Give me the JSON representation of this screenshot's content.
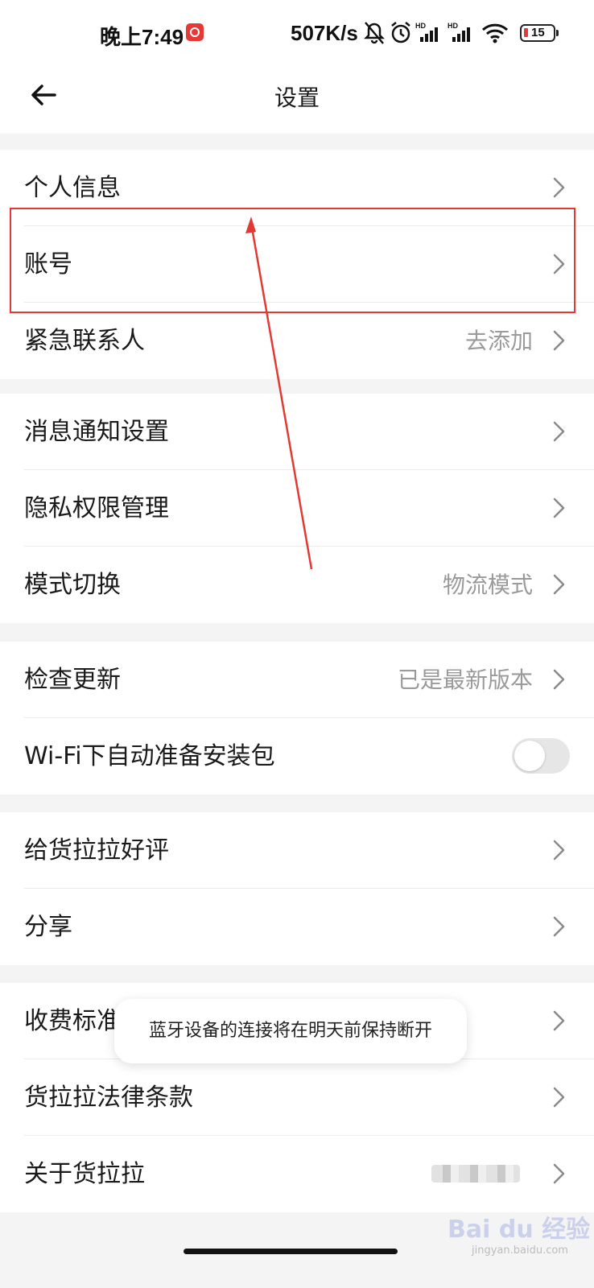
{
  "status_bar": {
    "time": "晚上7:49",
    "net_speed": "507K/s",
    "battery_level": "15",
    "icons": [
      "bell-muted-icon",
      "alarm-icon",
      "signal-hd-icon",
      "signal-hd-icon",
      "wifi-icon",
      "battery-icon"
    ]
  },
  "header": {
    "title": "设置",
    "back_icon": "arrow-left-icon"
  },
  "groups": [
    {
      "rows": [
        {
          "label": "个人信息",
          "value": ""
        },
        {
          "label": "账号",
          "value": ""
        },
        {
          "label": "紧急联系人",
          "value": "去添加"
        }
      ]
    },
    {
      "rows": [
        {
          "label": "消息通知设置",
          "value": ""
        },
        {
          "label": "隐私权限管理",
          "value": ""
        },
        {
          "label": "模式切换",
          "value": "物流模式"
        }
      ]
    },
    {
      "rows": [
        {
          "label": "检查更新",
          "value": "已是最新版本"
        },
        {
          "label": "Wi-Fi下自动准备安装包",
          "toggle_on": false
        }
      ]
    },
    {
      "rows": [
        {
          "label": "给货拉拉好评",
          "value": ""
        },
        {
          "label": "分享",
          "value": ""
        }
      ]
    },
    {
      "rows": [
        {
          "label": "收费标准",
          "value": ""
        },
        {
          "label": "货拉拉法律条款",
          "value": ""
        },
        {
          "label": "关于货拉拉",
          "value": ""
        }
      ]
    }
  ],
  "toast": "蓝牙设备的连接将在明天前保持断开",
  "watermark": {
    "text": "Bai du 经验",
    "sub": "jingyan.baidu.com"
  },
  "colors": {
    "background": "#f4f4f5",
    "highlight": "#e03a32",
    "secondary_text": "#9a9a9a"
  }
}
